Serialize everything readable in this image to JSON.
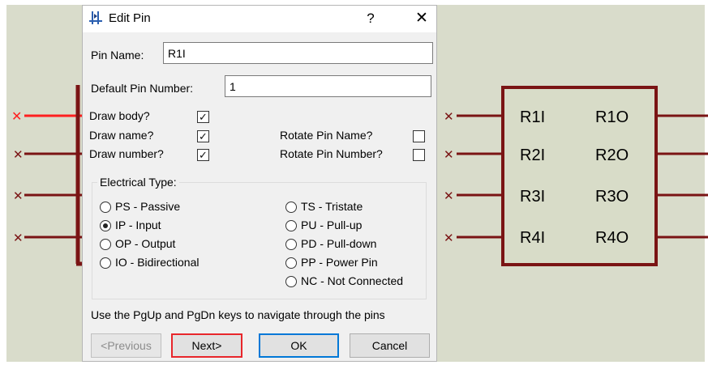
{
  "dialog": {
    "title": "Edit Pin",
    "help": "?",
    "close": "✕",
    "pin_name": {
      "label": "Pin Name:",
      "value": "R1I"
    },
    "default_pin_number": {
      "label": "Default Pin Number:",
      "value": "1"
    },
    "checks": [
      {
        "label": "Draw body?",
        "checked": true,
        "mark": "✓"
      },
      {
        "label": "Draw name?",
        "checked": true,
        "mark": "✓"
      },
      {
        "label": "Draw number?",
        "checked": true,
        "mark": "✓"
      },
      {
        "label": "Rotate Pin Name?",
        "checked": false,
        "mark": ""
      },
      {
        "label": "Rotate Pin Number?",
        "checked": false,
        "mark": ""
      }
    ],
    "electrical_type": {
      "title": "Electrical Type:",
      "options": [
        {
          "label": "PS - Passive",
          "selected": false
        },
        {
          "label": "IP - Input",
          "selected": true
        },
        {
          "label": "OP - Output",
          "selected": false
        },
        {
          "label": "IO - Bidirectional",
          "selected": false
        },
        {
          "label": "TS - Tristate",
          "selected": false
        },
        {
          "label": "PU - Pull-up",
          "selected": false
        },
        {
          "label": "PD - Pull-down",
          "selected": false
        },
        {
          "label": "PP - Power Pin",
          "selected": false
        },
        {
          "label": "NC - Not Connected",
          "selected": false
        }
      ]
    },
    "hint": "Use the PgUp and PgDn keys to navigate through the pins",
    "buttons": {
      "previous": "<Previous",
      "next": "Next>",
      "ok": "OK",
      "cancel": "Cancel"
    }
  },
  "component": {
    "pins_left": [
      "R1I",
      "R2I",
      "R3I",
      "R4I"
    ],
    "pins_right": [
      "R1O",
      "R2O",
      "R3O",
      "R4O"
    ]
  },
  "colors": {
    "body_outline": "#7a1414",
    "body_fill": "#d8dcc8",
    "selected_pin": "#ff2020",
    "pin": "#7a1414",
    "highlight": "#e8262b",
    "focus": "#0078d7"
  }
}
